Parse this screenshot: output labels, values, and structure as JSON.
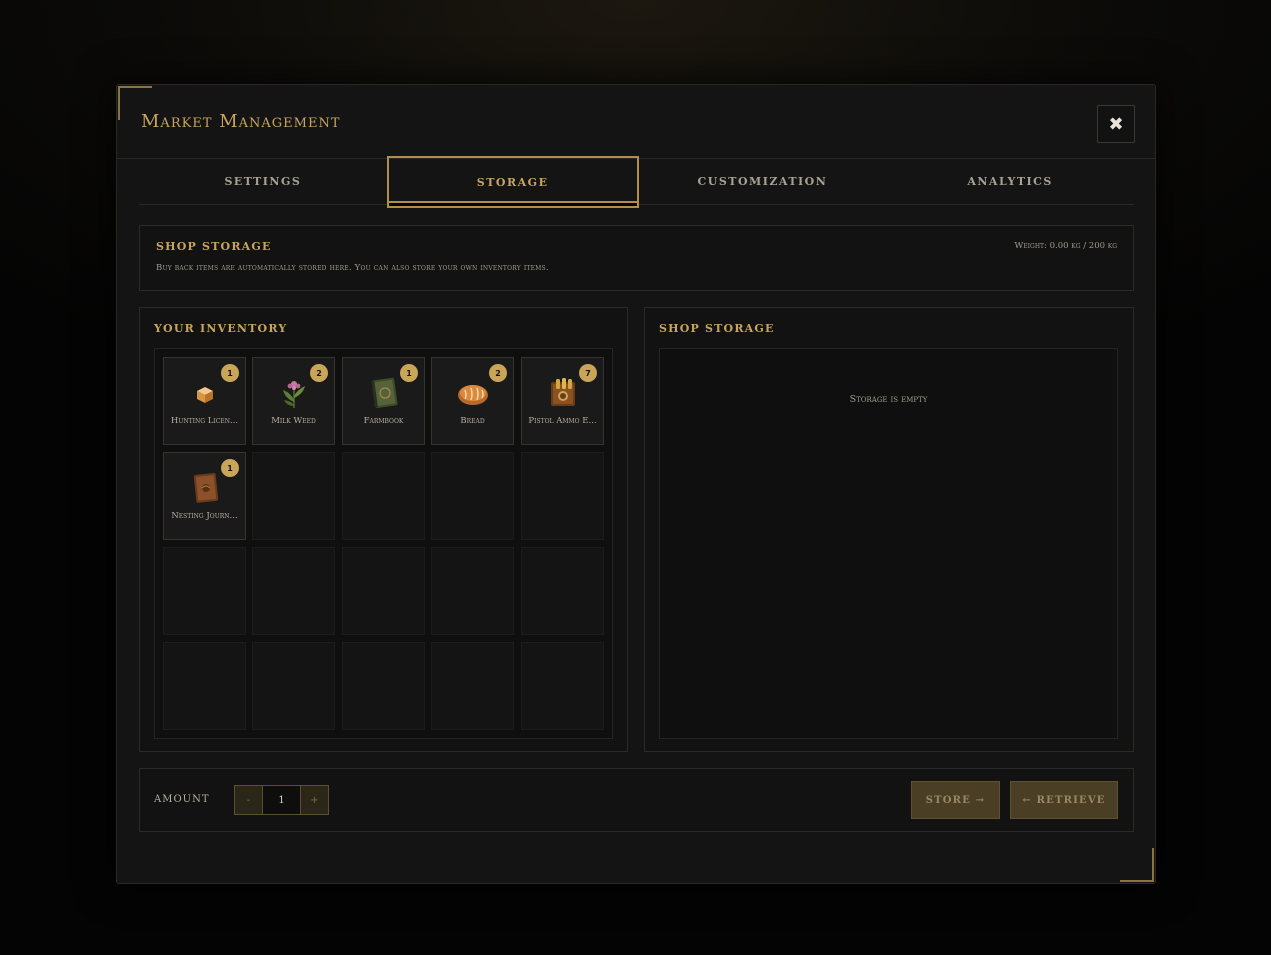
{
  "modal": {
    "title": "Market Management",
    "close_label": "✖"
  },
  "tabs": [
    {
      "label": "SETTINGS",
      "active": false
    },
    {
      "label": "STORAGE",
      "active": true
    },
    {
      "label": "CUSTOMIZATION",
      "active": false
    },
    {
      "label": "ANALYTICS",
      "active": false
    }
  ],
  "info": {
    "title": "SHOP STORAGE",
    "description": "Buy back items are automatically stored here. You can also store your own inventory items.",
    "weight": "Weight: 0.00 kg / 200 kg"
  },
  "inventory": {
    "title": "YOUR INVENTORY",
    "items": [
      {
        "name": "Hunting Licen...",
        "count": "1",
        "icon": "box-icon"
      },
      {
        "name": "Milk Weed",
        "count": "2",
        "icon": "plant-icon"
      },
      {
        "name": "Farmbook",
        "count": "1",
        "icon": "book-icon"
      },
      {
        "name": "Bread",
        "count": "2",
        "icon": "bread-icon"
      },
      {
        "name": "Pistol Ammo E...",
        "count": "7",
        "icon": "ammo-icon"
      },
      {
        "name": "Nesting Journ...",
        "count": "1",
        "icon": "journal-icon"
      }
    ],
    "total_slots": 20
  },
  "storage": {
    "title": "SHOP STORAGE",
    "empty_text": "Storage is empty"
  },
  "footer": {
    "amount_label": "AMOUNT",
    "minus_label": "-",
    "amount_value": "1",
    "plus_label": "+",
    "store_label": "STORE →",
    "retrieve_label": "← RETRIEVE"
  },
  "colors": {
    "accent": "#c9a55a",
    "button_bg": "#4a3f25"
  }
}
